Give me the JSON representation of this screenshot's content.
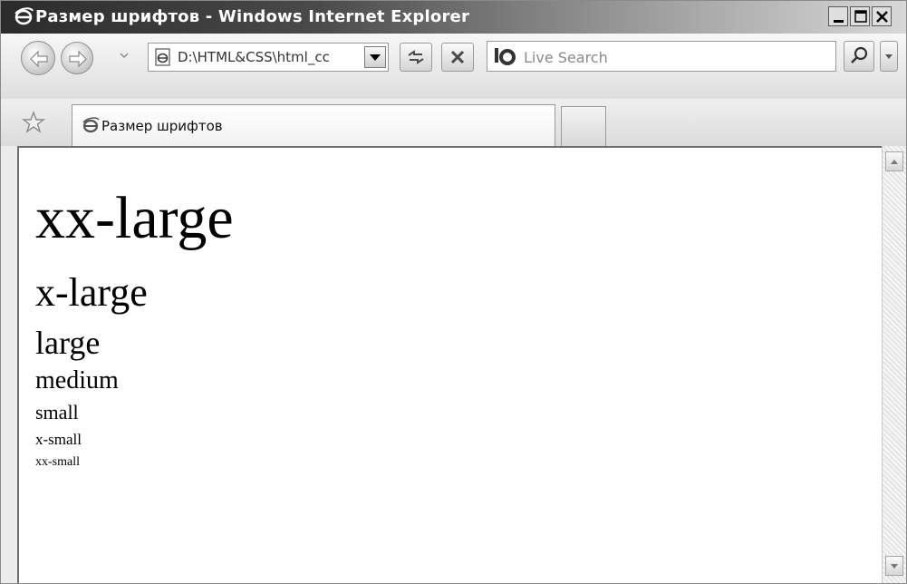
{
  "window": {
    "title": "Размер шрифтов - Windows Internet Explorer"
  },
  "nav": {
    "address_value": "D:\\HTML&CSS\\html_cc",
    "search_placeholder": "Live Search"
  },
  "tabs": [
    {
      "label": "Размер шрифтов"
    }
  ],
  "content": {
    "lines": [
      "xx-large",
      "x-large",
      "large",
      "medium",
      "small",
      "x-small",
      "xx-small"
    ]
  }
}
